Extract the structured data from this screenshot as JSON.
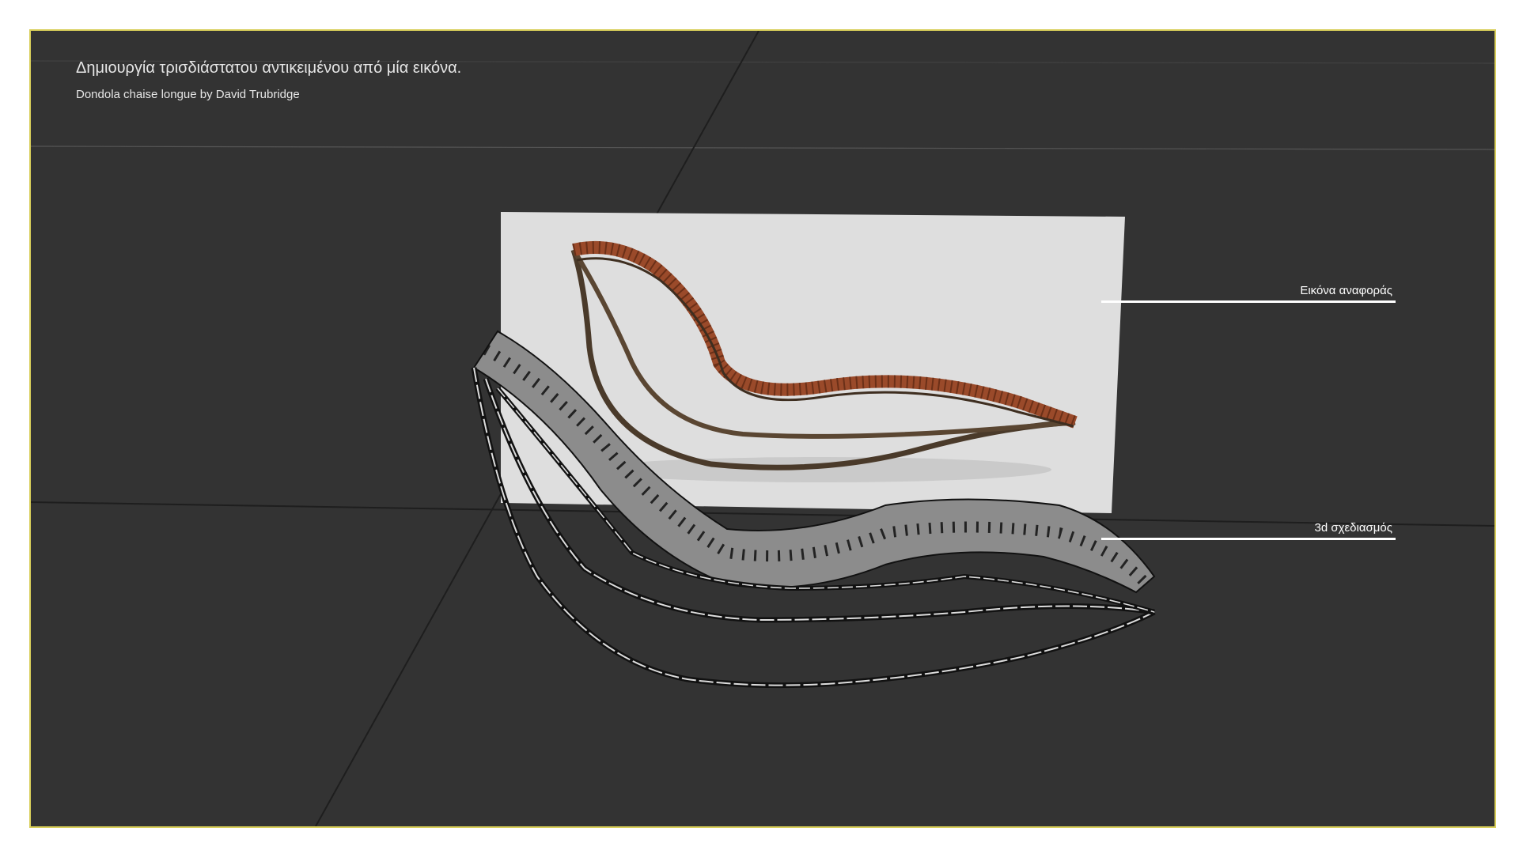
{
  "slide": {
    "title": "Δημιουργία τρισδιάστατου αντικειμένου από μία εικόνα.",
    "subtitle": "Dondola chaise longue by David Trubridge"
  },
  "annotations": {
    "reference_image_label": "Εικόνα αναφοράς",
    "model_label": "3d σχεδιασμός"
  },
  "colors": {
    "viewport_background": "#333333",
    "frame_border": "#d9cf5a",
    "reference_panel": "#dedede",
    "wood_slats": "#9a4a2a",
    "wood_frame": "#4a3a2a",
    "wireframe": "#111111",
    "slat_fill": "#8c8c8c"
  }
}
